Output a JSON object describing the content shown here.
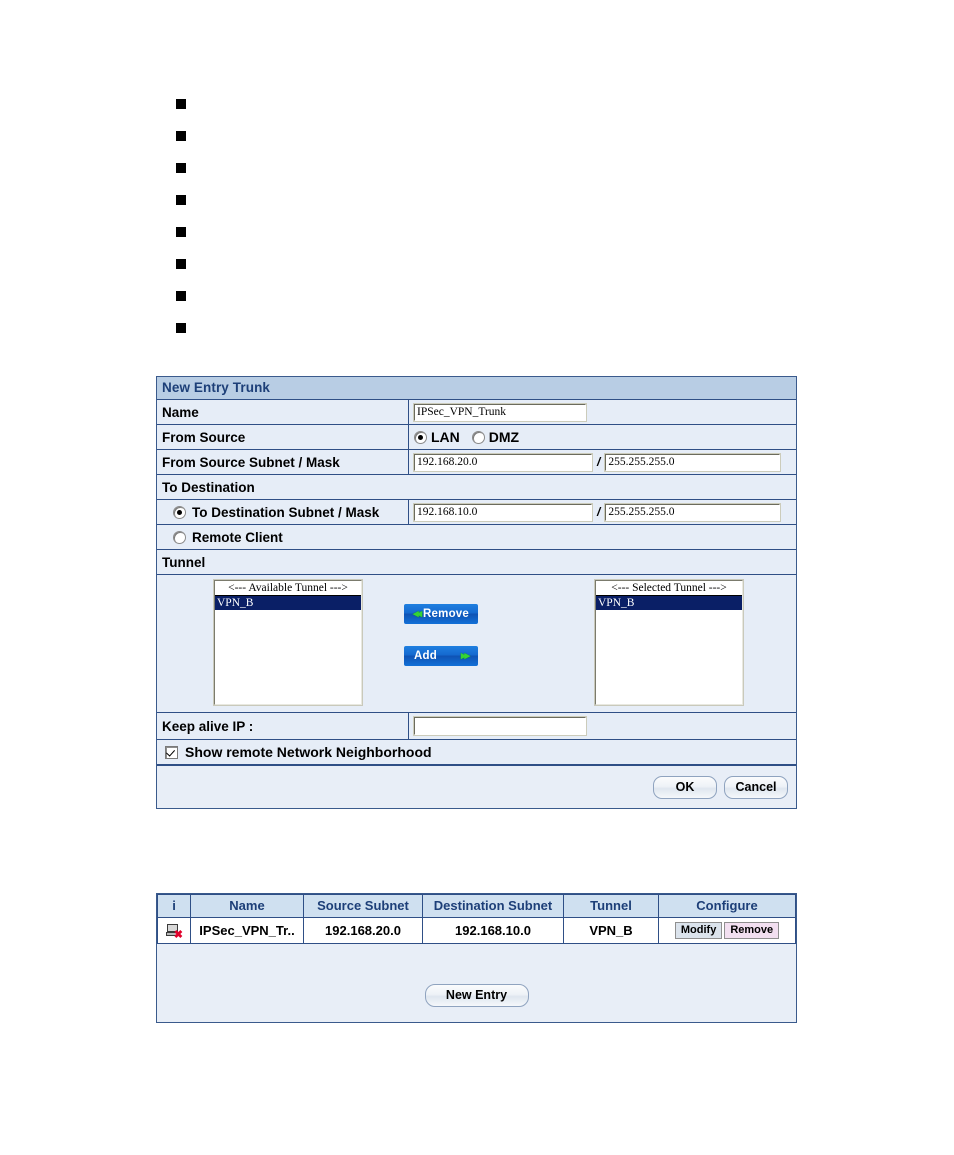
{
  "bullets": {
    "count": 8,
    "items": [
      "",
      "",
      "",
      "",
      "",
      "",
      "",
      ""
    ]
  },
  "form": {
    "title": "New Entry Trunk",
    "name_label": "Name",
    "name_value": "IPSec_VPN_Trunk",
    "from_source_label": "From Source",
    "from_source_options": [
      "LAN",
      "DMZ"
    ],
    "from_source_selected": "LAN",
    "from_subnet_label": "From Source Subnet / Mask",
    "from_subnet_value": "192.168.20.0",
    "from_mask_value": "255.255.255.0",
    "slash": "/",
    "to_destination_label": "To Destination",
    "to_dest_subnet_label": "To Destination Subnet / Mask",
    "to_dest_subnet_value": "192.168.10.0",
    "to_dest_mask_value": "255.255.255.0",
    "remote_client_label": "Remote Client",
    "tunnel_label": "Tunnel",
    "available_tunnel_header": "<--- Available Tunnel --->",
    "available_tunnel_items": [
      "VPN_B"
    ],
    "selected_tunnel_header": "<--- Selected Tunnel --->",
    "selected_tunnel_items": [
      "VPN_B"
    ],
    "remove_button": "Remove",
    "add_button": "Add",
    "keep_alive_label": "Keep alive IP :",
    "keep_alive_value": "",
    "show_neighborhood_label": "Show remote Network Neighborhood",
    "show_neighborhood_checked": true,
    "ok_button": "OK",
    "cancel_button": "Cancel"
  },
  "results": {
    "columns": [
      "i",
      "Name",
      "Source Subnet",
      "Destination Subnet",
      "Tunnel",
      "Configure"
    ],
    "rows": [
      {
        "icon": "computer-disconnected-icon",
        "name": "IPSec_VPN_Tr..",
        "source_subnet": "192.168.20.0",
        "destination_subnet": "192.168.10.0",
        "tunnel": "VPN_B",
        "modify_label": "Modify",
        "remove_label": "Remove"
      }
    ],
    "new_entry_button": "New Entry"
  },
  "colors": {
    "panel_border": "#3a5a8c",
    "title_bar": "#b8cde4",
    "title_text": "#1d3f78",
    "row_bg": "#e6edf7",
    "header_bg": "#cfe0f0",
    "selected_item_bg": "#0a1f66",
    "blue_button": "#1569cf",
    "green_chevron": "#35d435",
    "remove_button_bg": "#f2dff0",
    "modify_button_bg": "#dbe3ec"
  }
}
